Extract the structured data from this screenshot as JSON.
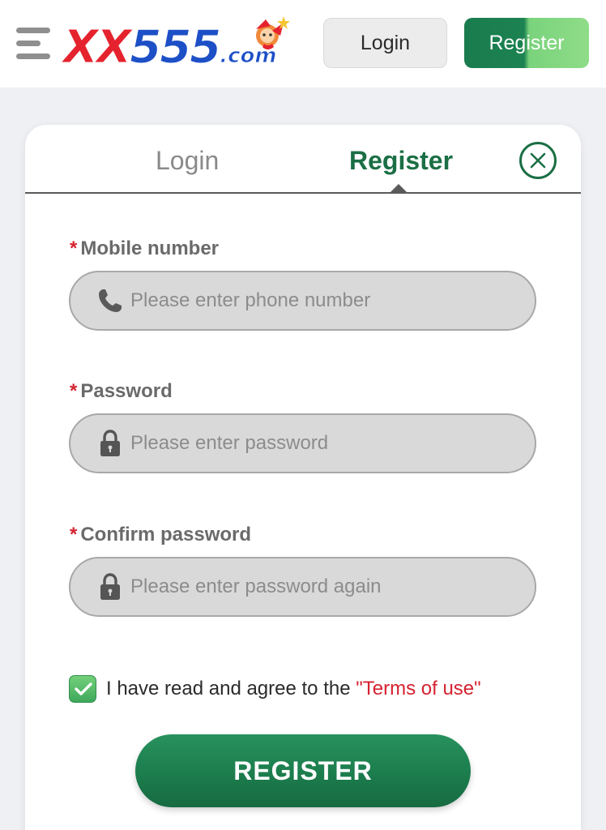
{
  "header": {
    "logo_main": "XX",
    "logo_number": "555",
    "logo_domain": ".com",
    "login_label": "Login",
    "register_label": "Register",
    "menu_icon": "hamburger-menu-icon"
  },
  "modal": {
    "tabs": [
      {
        "label": "Login",
        "active": false
      },
      {
        "label": "Register",
        "active": true
      }
    ],
    "close_icon": "close-circle-icon",
    "required_mark": "*",
    "fields": [
      {
        "label": "Mobile number",
        "placeholder": "Please enter phone number",
        "value": "",
        "icon": "phone-icon"
      },
      {
        "label": "Password",
        "placeholder": "Please enter password",
        "value": "",
        "icon": "lock-icon"
      },
      {
        "label": "Confirm password",
        "placeholder": "Please enter password again",
        "value": "",
        "icon": "lock-icon"
      }
    ],
    "agreement": {
      "checked": true,
      "text": "I have read and agree to the ",
      "link_text": "\"Terms of use\""
    },
    "submit_label": "REGISTER"
  },
  "colors": {
    "brand_green": "#1b6f45",
    "accent_red": "#d52230",
    "logo_red": "#e5232e",
    "logo_blue": "#1d4fc6",
    "page_background": "#eef0f4"
  }
}
